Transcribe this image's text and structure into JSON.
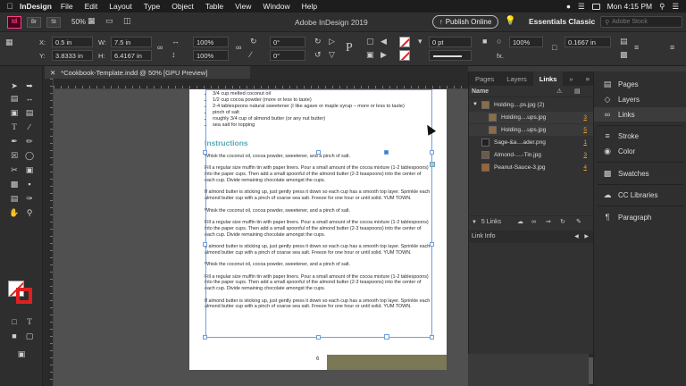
{
  "menubar": {
    "app_name": "InDesign",
    "items": [
      "File",
      "Edit",
      "Layout",
      "Type",
      "Object",
      "Table",
      "View",
      "Window",
      "Help"
    ],
    "clock": "Mon 4:15 PM"
  },
  "appbar": {
    "logo": "Id",
    "bridge": "Br",
    "stock": "St",
    "zoom": "50%",
    "title": "Adobe InDesign 2019",
    "publish_label": "Publish Online",
    "workspace": "Essentials Classic",
    "search_placeholder": "Adobe Stock"
  },
  "controlbar": {
    "x_label": "X:",
    "x_value": "0.5 in",
    "y_label": "Y:",
    "y_value": "3.8333 in",
    "w_label": "W:",
    "w_value": "7.5 in",
    "h_label": "H:",
    "h_value": "6.4167 in",
    "scale_x": "100%",
    "scale_y": "100%",
    "rotate": "0°",
    "shear": "0°",
    "stroke_weight": "0 pt",
    "scale_x2": "100%",
    "inset": "0.1667 in",
    "fx_label": "fx."
  },
  "document": {
    "tab_title": "*Cookbook-Template.indd @ 50% [GPU Preview]",
    "page_number": "6",
    "ingredients": [
      "3/4 cup melted coconut oil",
      "1/2 cup cocoa powder (more or less to taste)",
      "2-4 tablespoons natural sweetener (I like agave or maple syrup – more or less to taste)",
      "pinch of salt",
      "roughly 3/4 cup of almond butter (or any nut butter)",
      "sea salt for topping"
    ],
    "heading": "Instructions",
    "paragraphs": [
      "Whisk the coconut oil, cocoa powder, sweetener, and a pinch of salt.",
      "Fill a regular size muffin tin with paper liners. Pour a small amount of the cocoa mixture (1-2 tablespoons) into the paper cups. Then add a small spoonful of the almond butter (2-3 teaspoons) into the center of each cup. Divide remaining chocolate amongst the cups.",
      "If almond butter is sticking up, just gently press it down so each cup has a smooth top layer. Sprinkle each almond butter cup with a pinch of coarse sea salt. Freeze for one hour or until solid. YUM TOWN.",
      "Whisk the coconut oil, cocoa powder, sweetener, and a pinch of salt.",
      "Fill a regular size muffin tin with paper liners. Pour a small amount of the cocoa mixture (1-2 tablespoons) into the paper cups. Then add a small spoonful of the almond butter (2-3 teaspoons) into the center of each cup. Divide remaining chocolate amongst the cups.",
      "If almond butter is sticking up, just gently press it down so each cup has a smooth top layer. Sprinkle each almond butter cup with a pinch of coarse sea salt. Freeze for one hour or until solid. YUM TOWN.",
      "Whisk the coconut oil, cocoa powder, sweetener, and a pinch of salt.",
      "Fill a regular size muffin tin with paper liners. Pour a small amount of the cocoa mixture (1-2 tablespoons) into the paper cups. Then add a small spoonful of the almond butter (2-3 teaspoons) into the center of each cup. Divide remaining chocolate amongst the cups.",
      "If almond butter is sticking up, just gently press it down so each cup has a smooth top layer. Sprinkle each almond butter cup with a pinch of coarse sea salt. Freeze for one hour or until solid. YUM TOWN."
    ]
  },
  "links_panel": {
    "tabs": [
      "Pages",
      "Layers",
      "Links"
    ],
    "active_tab": "Links",
    "column_name": "Name",
    "links": [
      {
        "name": "Holding....ps.jpg (2)",
        "page": "",
        "level": 0
      },
      {
        "name": "Holding....ups.jpg",
        "page": "3",
        "level": 1
      },
      {
        "name": "Holding....ups.jpg",
        "page": "5",
        "level": 1
      },
      {
        "name": "Sage-&a....ader.png",
        "page": "1",
        "level": 0
      },
      {
        "name": "Almond-....-Tin.jpg",
        "page": "3",
        "level": 0
      },
      {
        "name": "Peanut-Sauce-3.jpg",
        "page": "4",
        "level": 0
      }
    ],
    "count_label": "5 Links",
    "info_label": "Link Info"
  },
  "dock": {
    "items": [
      {
        "label": "Pages",
        "icon": "pages-icon"
      },
      {
        "label": "Layers",
        "icon": "layers-icon"
      },
      {
        "label": "Links",
        "icon": "links-icon"
      },
      {
        "label": "Stroke",
        "icon": "stroke-icon"
      },
      {
        "label": "Color",
        "icon": "color-icon"
      },
      {
        "label": "Swatches",
        "icon": "swatches-icon"
      },
      {
        "label": "CC Libraries",
        "icon": "cc-libraries-icon"
      },
      {
        "label": "Paragraph",
        "icon": "paragraph-icon"
      }
    ],
    "active": "Links"
  },
  "colors": {
    "heading": "#57a9b4",
    "footer_bar": "#7b7855",
    "frame_selection": "#6fa0d8",
    "link_page": "#e8a030"
  }
}
